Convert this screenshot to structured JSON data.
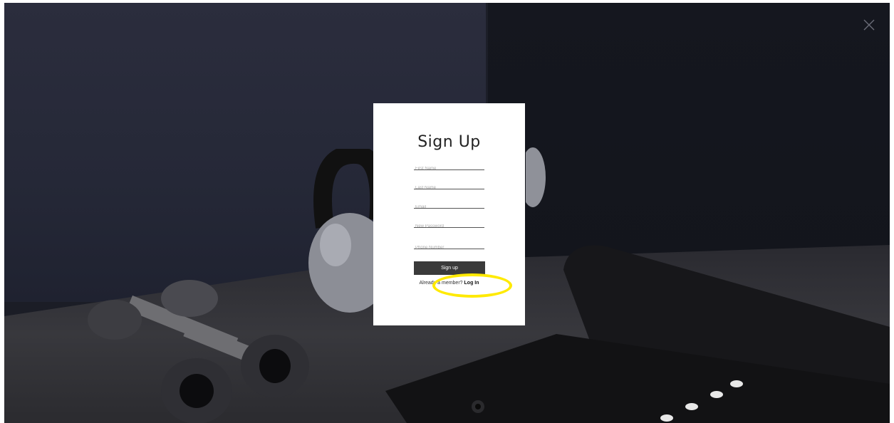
{
  "page": {
    "close_icon": "close-icon"
  },
  "signup_form": {
    "title": "Sign Up",
    "fields": {
      "first_name": {
        "placeholder": "First Name",
        "value": ""
      },
      "last_name": {
        "placeholder": "Last Name",
        "value": ""
      },
      "email": {
        "placeholder": "Email",
        "value": ""
      },
      "new_password": {
        "placeholder": "New Password",
        "value": ""
      },
      "phone_number": {
        "placeholder": "Phone Number",
        "value": ""
      }
    },
    "submit_label": "Sign up",
    "member_prompt": "Already a member?",
    "login_label": "Log In"
  },
  "annotation": {
    "highlight_color": "#ffea00"
  },
  "colors": {
    "button_bg": "#3a3a3a",
    "modal_bg": "#ffffff"
  }
}
